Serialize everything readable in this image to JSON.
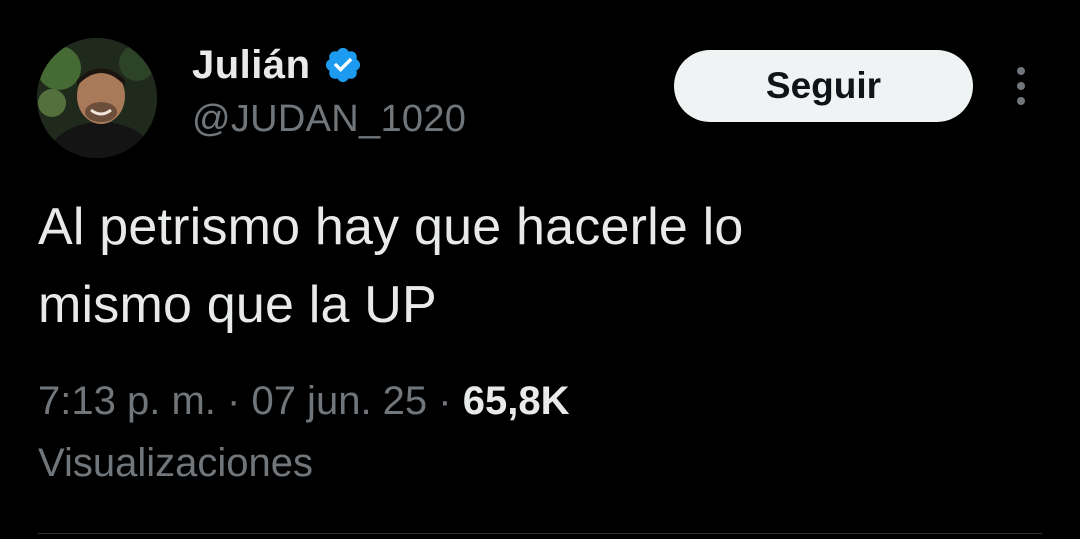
{
  "user": {
    "display_name": "Julián",
    "handle": "@JUDAN_1020",
    "verified": true,
    "verified_color": "#1d9bf0",
    "avatar_icon": "profile-photo"
  },
  "actions": {
    "follow_label": "Seguir",
    "more_icon": "more-vertical-icon"
  },
  "tweet": {
    "text_line1": "Al petrismo hay que hacerle lo",
    "text_line2": "mismo que la UP"
  },
  "meta": {
    "time": "7:13 p. m.",
    "separator": "·",
    "date": "07 jun. 25",
    "views_count": "65,8K",
    "views_label": "Visualizaciones"
  },
  "colors": {
    "background": "#000000",
    "text": "#e7e9ea",
    "secondary": "#71767b",
    "button_bg": "#eff3f4"
  }
}
